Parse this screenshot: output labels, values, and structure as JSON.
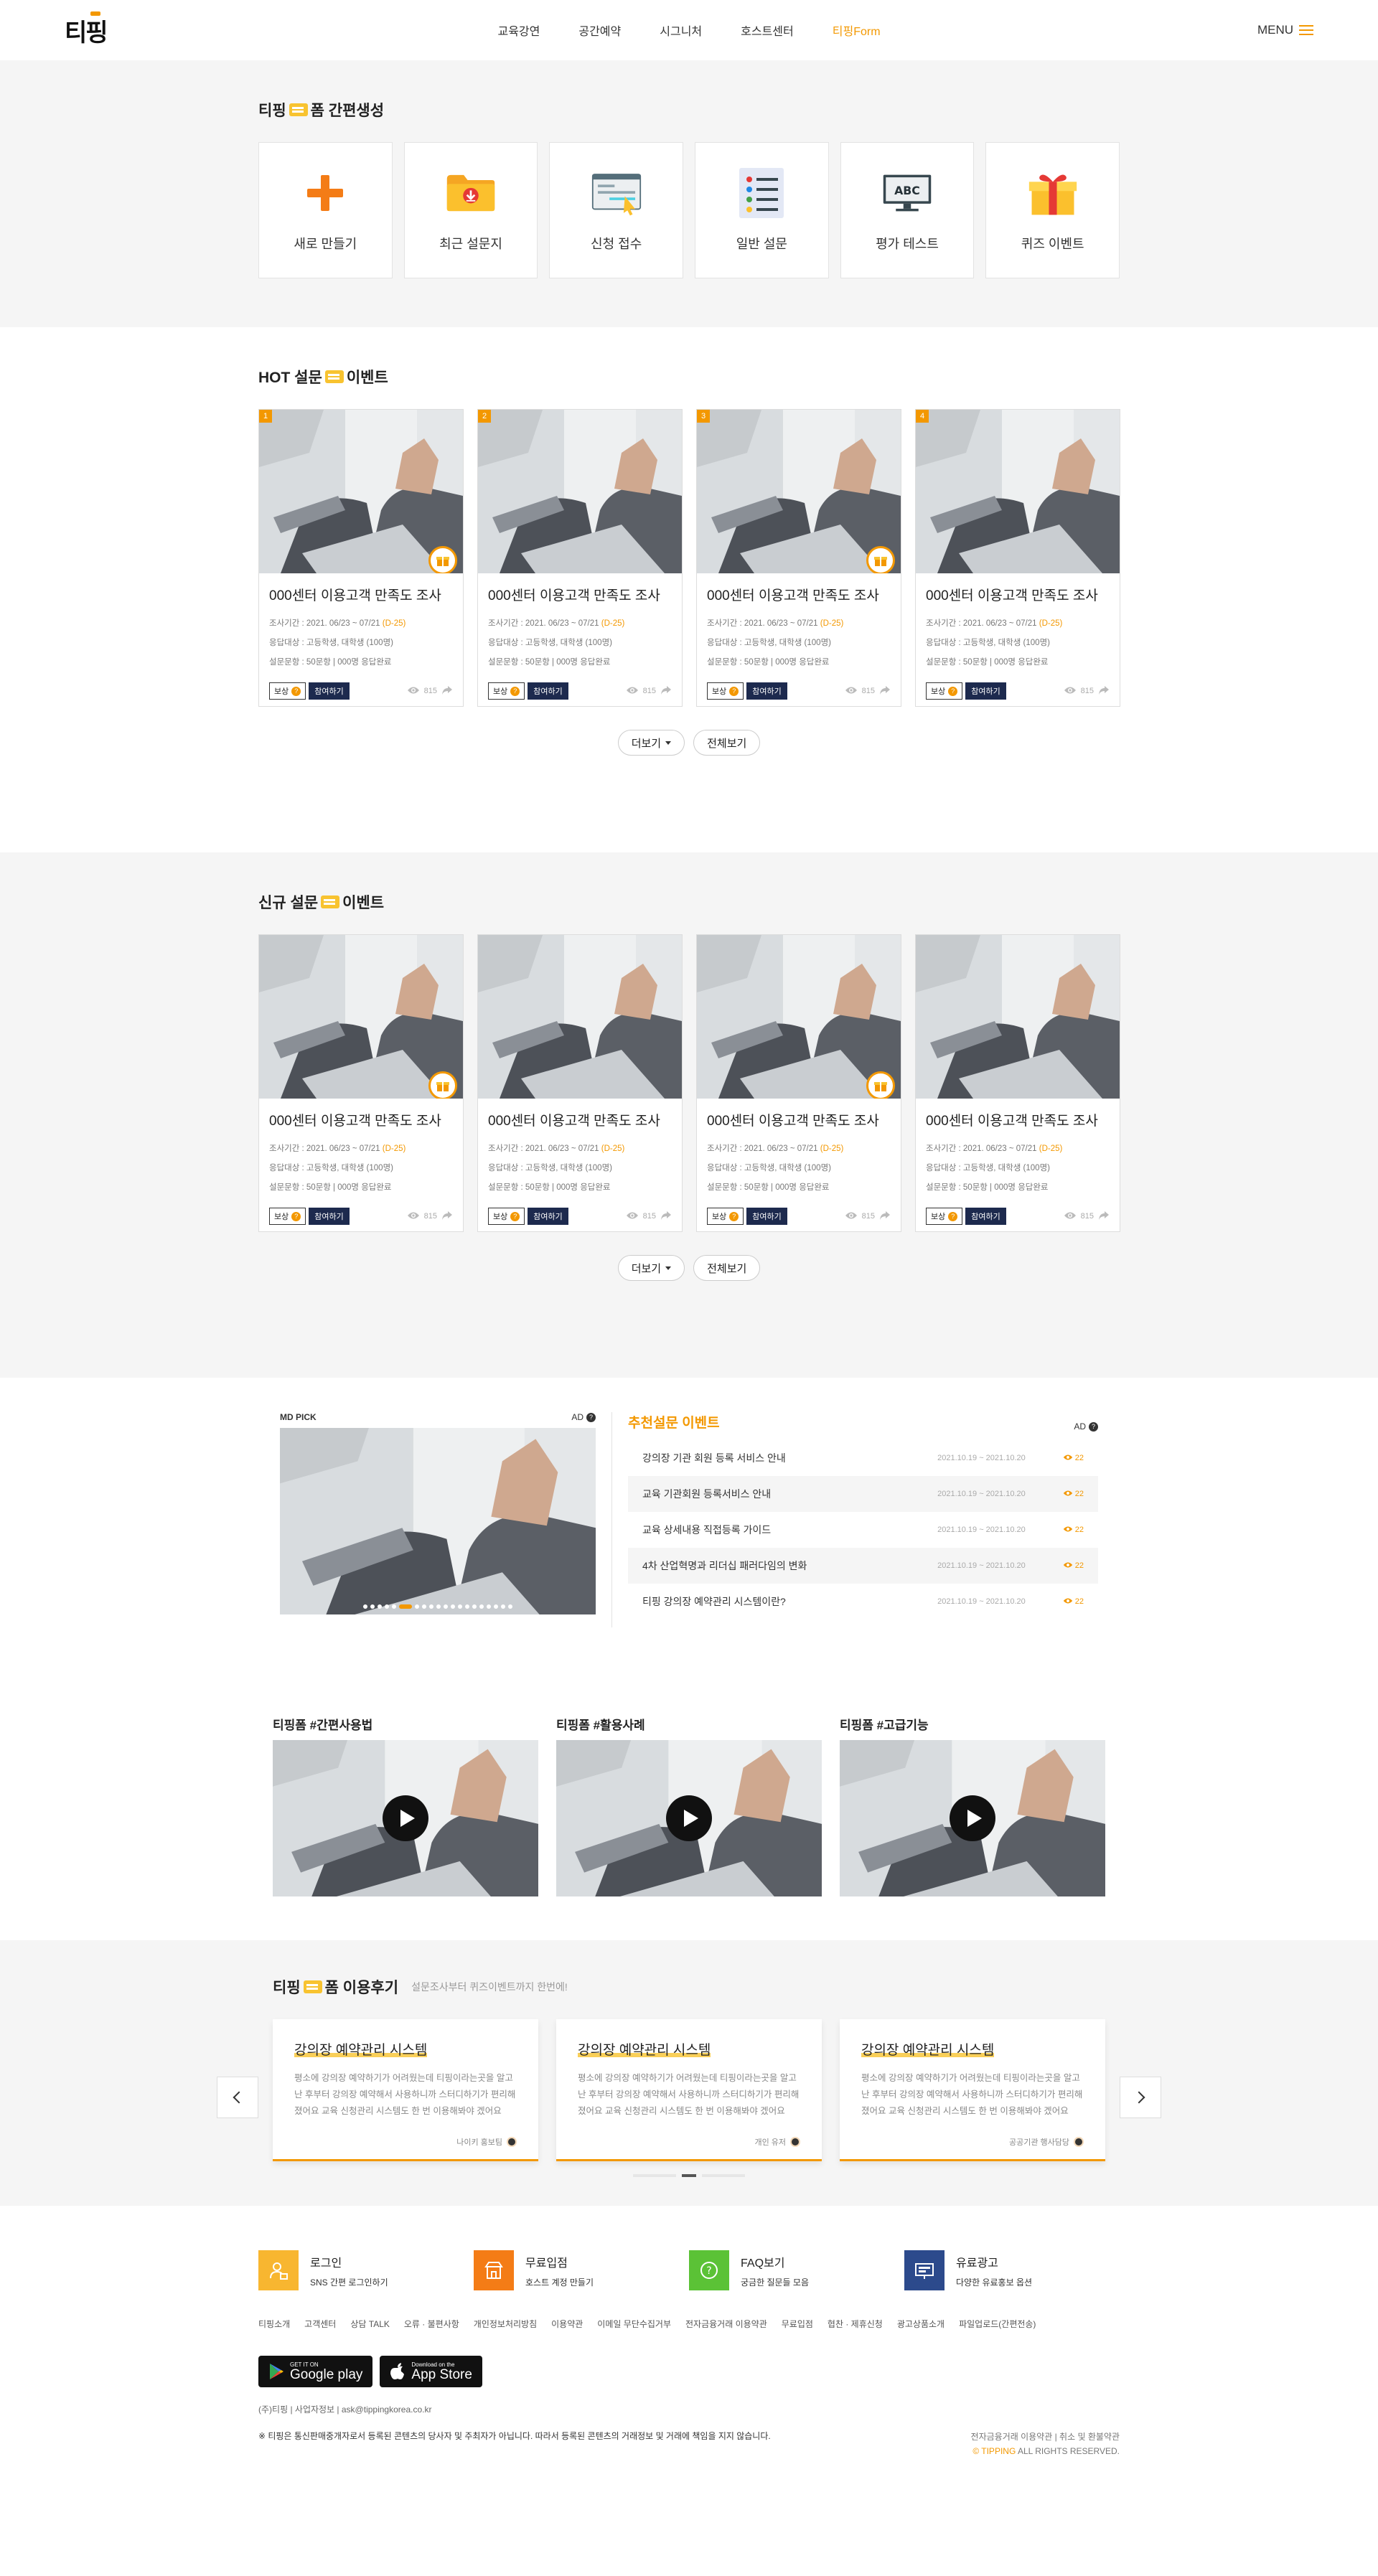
{
  "header": {
    "logo": "티핑",
    "nav": [
      "교육강연",
      "공간예약",
      "시그니처",
      "호스트센터",
      "티핑Form"
    ],
    "menu_label": "MENU"
  },
  "quick": {
    "title_a": "티핑",
    "title_b": "폼 간편생성",
    "cards": [
      {
        "label": "새로 만들기",
        "icon": "plus-icon"
      },
      {
        "label": "최근 설문지",
        "icon": "folder-download-icon"
      },
      {
        "label": "신청 접수",
        "icon": "application-form-icon"
      },
      {
        "label": "일반 설문",
        "icon": "checklist-icon"
      },
      {
        "label": "평가 테스트",
        "icon": "abc-monitor-icon"
      },
      {
        "label": "퀴즈 이벤트",
        "icon": "gift-box-icon"
      }
    ]
  },
  "hot": {
    "title_a": "HOT 설문",
    "title_b": "이벤트",
    "cards": [
      {
        "rank": "1",
        "title": "000센터 이용고객 만족도 조사",
        "period": "조사기간 : 2021. 06/23 ~ 07/21",
        "dday": "(D-25)",
        "target": "응답대상 : 고등학생, 대학생 (100명)",
        "questions": "설문문항 : 50문항 | 000명 응답완료",
        "reward": "보상",
        "join": "참여하기",
        "views": "815",
        "gift": true
      },
      {
        "rank": "2",
        "title": "000센터 이용고객 만족도 조사",
        "period": "조사기간 : 2021. 06/23 ~ 07/21",
        "dday": "(D-25)",
        "target": "응답대상 : 고등학생, 대학생 (100명)",
        "questions": "설문문항 : 50문항 | 000명 응답완료",
        "reward": "보상",
        "join": "참여하기",
        "views": "815",
        "gift": false
      },
      {
        "rank": "3",
        "title": "000센터 이용고객 만족도 조사",
        "period": "조사기간 : 2021. 06/23 ~ 07/21",
        "dday": "(D-25)",
        "target": "응답대상 : 고등학생, 대학생 (100명)",
        "questions": "설문문항 : 50문항 | 000명 응답완료",
        "reward": "보상",
        "join": "참여하기",
        "views": "815",
        "gift": true
      },
      {
        "rank": "4",
        "title": "000센터 이용고객 만족도 조사",
        "period": "조사기간 : 2021. 06/23 ~ 07/21",
        "dday": "(D-25)",
        "target": "응답대상 : 고등학생, 대학생 (100명)",
        "questions": "설문문항 : 50문항 | 000명 응답완료",
        "reward": "보상",
        "join": "참여하기",
        "views": "815",
        "gift": false
      }
    ],
    "more": "더보기",
    "all": "전체보기"
  },
  "newest": {
    "title_a": "신규 설문",
    "title_b": "이벤트",
    "cards": [
      {
        "title": "000센터 이용고객 만족도 조사",
        "period": "조사기간 : 2021. 06/23 ~ 07/21",
        "dday": "(D-25)",
        "target": "응답대상 : 고등학생, 대학생 (100명)",
        "questions": "설문문항 : 50문항 | 000명 응답완료",
        "reward": "보상",
        "join": "참여하기",
        "views": "815",
        "gift": true
      },
      {
        "title": "000센터 이용고객 만족도 조사",
        "period": "조사기간 : 2021. 06/23 ~ 07/21",
        "dday": "(D-25)",
        "target": "응답대상 : 고등학생, 대학생 (100명)",
        "questions": "설문문항 : 50문항 | 000명 응답완료",
        "reward": "보상",
        "join": "참여하기",
        "views": "815",
        "gift": false
      },
      {
        "title": "000센터 이용고객 만족도 조사",
        "period": "조사기간 : 2021. 06/23 ~ 07/21",
        "dday": "(D-25)",
        "target": "응답대상 : 고등학생, 대학생 (100명)",
        "questions": "설문문항 : 50문항 | 000명 응답완료",
        "reward": "보상",
        "join": "참여하기",
        "views": "815",
        "gift": true
      },
      {
        "title": "000센터 이용고객 만족도 조사",
        "period": "조사기간 : 2021. 06/23 ~ 07/21",
        "dday": "(D-25)",
        "target": "응답대상 : 고등학생, 대학생 (100명)",
        "questions": "설문문항 : 50문항 | 000명 응답완료",
        "reward": "보상",
        "join": "참여하기",
        "views": "815",
        "gift": false
      }
    ],
    "more": "더보기",
    "all": "전체보기"
  },
  "mdpick": {
    "label": "MD PICK",
    "ad": "AD",
    "rec_title": "추천설문 이벤트",
    "rec_ad": "AD",
    "items": [
      {
        "title": "강의장 기관 회원 등록 서비스 안내",
        "date": "2021.10.19 ~ 2021.10.20",
        "count": "22"
      },
      {
        "title": "교육 기관회원 등록서비스 안내",
        "date": "2021.10.19 ~ 2021.10.20",
        "count": "22"
      },
      {
        "title": "교육 상세내용 직접등록 가이드",
        "date": "2021.10.19 ~ 2021.10.20",
        "count": "22"
      },
      {
        "title": "4차 산업혁명과 리더십 패러다임의 변화",
        "date": "2021.10.19 ~ 2021.10.20",
        "count": "22"
      },
      {
        "title": "티핑 강의장 예약관리 시스템이란?",
        "date": "2021.10.19 ~ 2021.10.20",
        "count": "22"
      }
    ]
  },
  "videos": [
    {
      "title": "티핑폼 #간편사용법"
    },
    {
      "title": "티핑폼 #활용사례"
    },
    {
      "title": "티핑폼 #고급기능"
    }
  ],
  "reviews": {
    "title_a": "티핑",
    "title_b": "폼 이용후기",
    "subtitle": "설문조사부터 퀴즈이벤트까지 한번에!",
    "cards": [
      {
        "title": "강의장 예약관리 시스템",
        "body": "평소에 강의장 예약하기가 어려웠는데 티핑이라는곳을 알고난 후부터 강의장 예약해서 사용하니까 스터디하기가 편리해졌어요 교육 신청관리 시스템도 한 번 이용해봐야 겠어요",
        "author": "나이키 홍보팀"
      },
      {
        "title": "강의장 예약관리 시스템",
        "body": "평소에 강의장 예약하기가 어려웠는데 티핑이라는곳을 알고난 후부터 강의장 예약해서 사용하니까 스터디하기가 편리해졌어요 교육 신청관리 시스템도 한 번 이용해봐야 겠어요",
        "author": "개인 유저"
      },
      {
        "title": "강의장 예약관리 시스템",
        "body": "평소에 강의장 예약하기가 어려웠는데 티핑이라는곳을 알고난 후부터 강의장 예약해서 사용하니까 스터디하기가 편리해졌어요 교육 신청관리 시스템도 한 번 이용해봐야 겠어요",
        "author": "공공기관 행사담당"
      }
    ]
  },
  "footer": {
    "services": [
      {
        "title": "로그인",
        "sub": "SNS 간편 로그인하기",
        "color": "#f8b630",
        "icon": "login-icon"
      },
      {
        "title": "무료입점",
        "sub": "호스트 계정 만들기",
        "color": "#f47c16",
        "icon": "store-icon"
      },
      {
        "title": "FAQ보기",
        "sub": "궁금한 질문들 모음",
        "color": "#5bc236",
        "icon": "question-icon"
      },
      {
        "title": "유료광고",
        "sub": "다양한 유료홍보 옵션",
        "color": "#2c4a8c",
        "icon": "billboard-icon"
      }
    ],
    "links": [
      "티핑소개",
      "고객센터",
      "상담 TALK",
      "오류 · 불편사항",
      "개인정보처리방침",
      "이용약관",
      "이메일 무단수집거부",
      "전자금융거래 이용약관",
      "무료입점",
      "협찬 · 제휴신청",
      "광고상품소개",
      "파일업로드(간편전송)"
    ],
    "google_small": "GET IT ON",
    "google_big": "Google play",
    "apple_small": "Download on the",
    "apple_big": "App Store",
    "info": "(주)티핑  |  사업자정보  |  ask@tippingkorea.co.kr",
    "notice": "※ 티핑은 통신판매중개자로서 등록된 콘텐츠의 당사자 및 주최자가 아닙니다. 따라서 등록된 콘텐츠의 거래정보 및 거래에 책임을 지지 않습니다.",
    "legal_links": "전자금융거래 이용약관  |  취소 및 환불약관",
    "copyright_brand": "© TIPPING",
    "copyright_rest": " ALL RIGHTS RESERVED."
  }
}
